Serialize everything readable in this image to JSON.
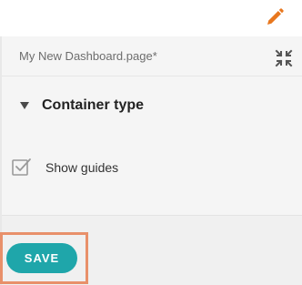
{
  "toolbar": {
    "edit_icon": "pencil-icon",
    "edit_color": "#e8771e"
  },
  "panel": {
    "page_name": "My New Dashboard.page*",
    "collapse_icon": "collapse-arrows-icon",
    "section": {
      "title": "Container type",
      "expanded": true,
      "icon": "caret-down-icon"
    },
    "show_guides": {
      "label": "Show guides",
      "checked": true,
      "icon": "checkbox-checked-icon"
    }
  },
  "footer": {
    "save_label": "SAVE",
    "save_color": "#1fa6aa",
    "highlight_color": "#e8906a"
  }
}
